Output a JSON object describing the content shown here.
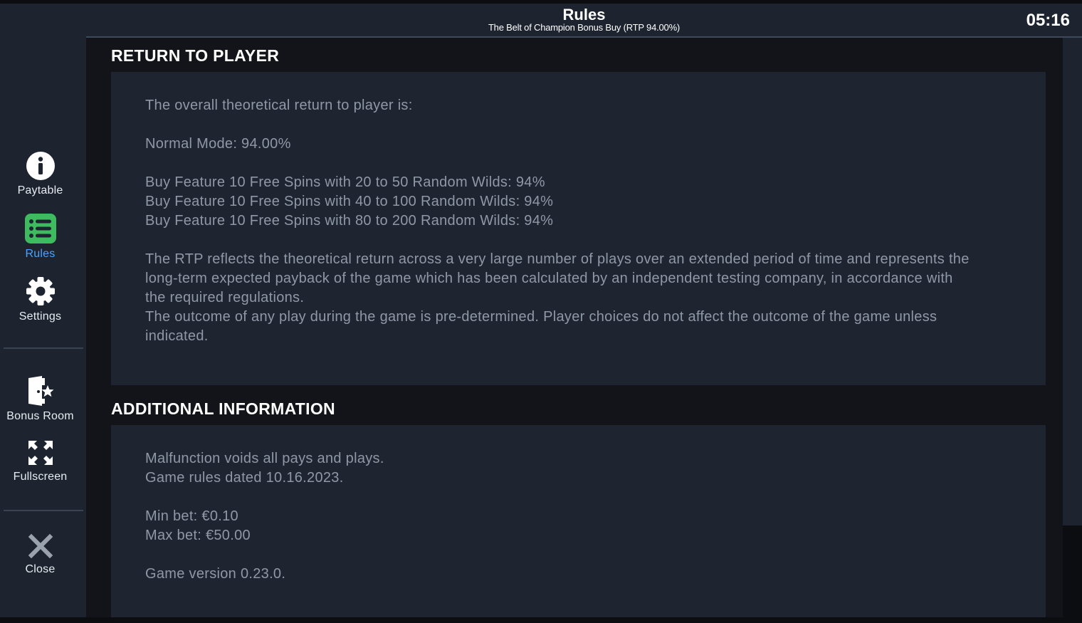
{
  "header": {
    "title": "Rules",
    "subtitle": "The Belt of Champion Bonus Buy (RTP 94.00%)",
    "clock": "05:16"
  },
  "sidebar": {
    "items": [
      {
        "label": "Paytable",
        "icon": "info-icon"
      },
      {
        "label": "Rules",
        "icon": "list-icon",
        "active": true
      },
      {
        "label": "Settings",
        "icon": "gear-icon"
      },
      {
        "label": "Bonus Room",
        "icon": "bonus-room-icon"
      },
      {
        "label": "Fullscreen",
        "icon": "fullscreen-icon"
      },
      {
        "label": "Close",
        "icon": "close-icon"
      }
    ]
  },
  "sections": {
    "rtp": {
      "title": "RETURN TO PLAYER",
      "intro": "The overall theoretical return to player is:",
      "normal_mode": "Normal Mode: 94.00%",
      "features": [
        "Buy Feature 10 Free Spins with 20 to 50 Random Wilds: 94%",
        "Buy Feature 10 Free Spins with 40 to 100 Random Wilds: 94%",
        "Buy Feature 10 Free Spins with 80 to 200 Random Wilds: 94%"
      ],
      "description": [
        "The RTP reflects the theoretical return across a very large number of plays over an extended period of time and represents the",
        "long-term expected payback of the game which has been calculated by an independent testing company, in accordance with",
        "the required regulations.",
        "The outcome of any play during the game is pre-determined. Player choices do not affect the outcome of the game unless",
        "indicated."
      ]
    },
    "additional": {
      "title": "ADDITIONAL INFORMATION",
      "malfunction": "Malfunction voids all pays and plays.",
      "rules_date": "Game rules dated 10.16.2023.",
      "min_bet": "Min bet: €0.10",
      "max_bet": "Max bet: €50.00",
      "version": "Game version 0.23.0."
    }
  },
  "colors": {
    "accent": "#4aa3ff",
    "rules_icon_green": "#3dbb5e",
    "body_text": "#8f98a6"
  }
}
